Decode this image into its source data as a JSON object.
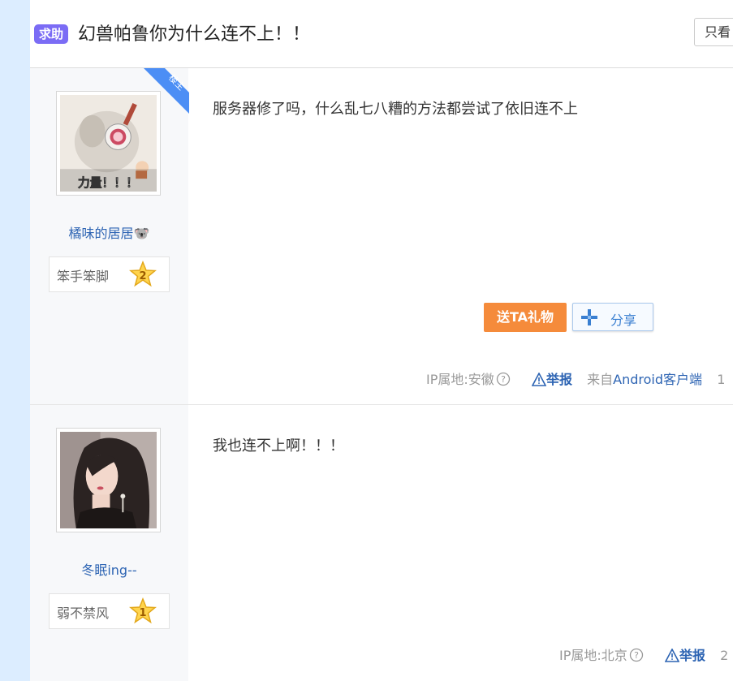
{
  "header": {
    "tag": "求助",
    "title": "幻兽帕鲁你为什么连不上！！",
    "only_lz_button": "只看"
  },
  "posts": [
    {
      "is_lz": true,
      "lz_corner": "楼主",
      "username": "橘味的居居🐨",
      "level_name": "笨手笨脚",
      "level_num": "2",
      "avatar_caption": "力量！！！",
      "content": "服务器修了吗，什么乱七八糟的方法都尝试了依旧连不上",
      "gift_button": "送TA礼物",
      "share_button": "分享",
      "ip_location": "IP属地:安徽",
      "report": "举报",
      "from_prefix": "来自",
      "from_client": "Android客户端",
      "floor": "1"
    },
    {
      "is_lz": false,
      "username": "冬眠ing--",
      "level_name": "弱不禁风",
      "level_num": "1",
      "content": "我也连不上啊！！！",
      "ip_location": "IP属地:北京",
      "report": "举报",
      "floor": "2"
    }
  ],
  "colors": {
    "tag_bg": "#7b6cf5",
    "link_blue": "#2d64b3",
    "gift_orange": "#f58b3b",
    "lz_corner_blue": "#4c8ef5",
    "side_strip": "#dcedff"
  }
}
